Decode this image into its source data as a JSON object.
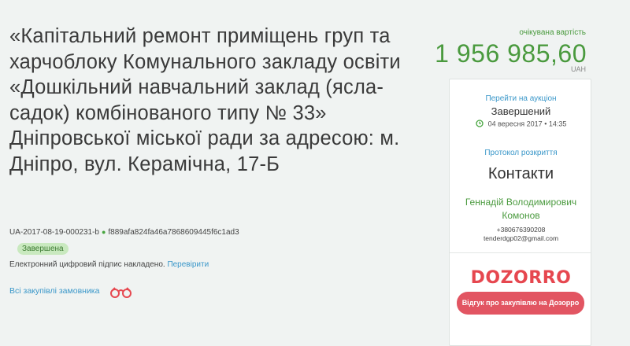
{
  "tender": {
    "title": "«Капітальний ремонт приміщень груп та харчоблоку Комунального закладу освіти «Дошкільний навчальний заклад (ясла-садок) комбінованого типу № 33» Дніпровської міської ради за адресою: м. Дніпро, вул. Керамічна, 17-Б",
    "id": "UA-2017-08-19-000231-b",
    "hash": "f889afa824fa46a7868609445f6c1ad3",
    "status_badge": "Завершена",
    "signature_text": "Електронний цифровий підпис накладено.",
    "verify_link": "Перевірити",
    "all_purchases_link": "Всі закупівлі замовника"
  },
  "price": {
    "label": "очікувана вартість",
    "amount": "1 956 985,60",
    "currency": "UAH"
  },
  "card": {
    "auction_link": "Перейти на аукціон",
    "auction_status": "Завершений",
    "auction_date": "04 вересня 2017",
    "auction_time": "14:35",
    "protocol_link": "Протокол розкриття",
    "contacts_title": "Контакти",
    "contact_name_line1": "Геннадій Володимирович",
    "contact_name_line2": "Комонов",
    "contact_phone": "+380676390208",
    "contact_email": "tenderdgp02@gmail.com",
    "dozorro_logo": "DOZORRO",
    "feedback_button": "Відгук про закупівлю на Дозорро"
  },
  "colors": {
    "accent_green": "#4a9a3e",
    "link_blue": "#3a97c9",
    "dozorro_red": "#e25562",
    "background": "#f0f3f2"
  },
  "icons": {
    "clock": "clock-icon",
    "binoculars": "binoculars-icon",
    "separator_dot": "dot-icon"
  }
}
